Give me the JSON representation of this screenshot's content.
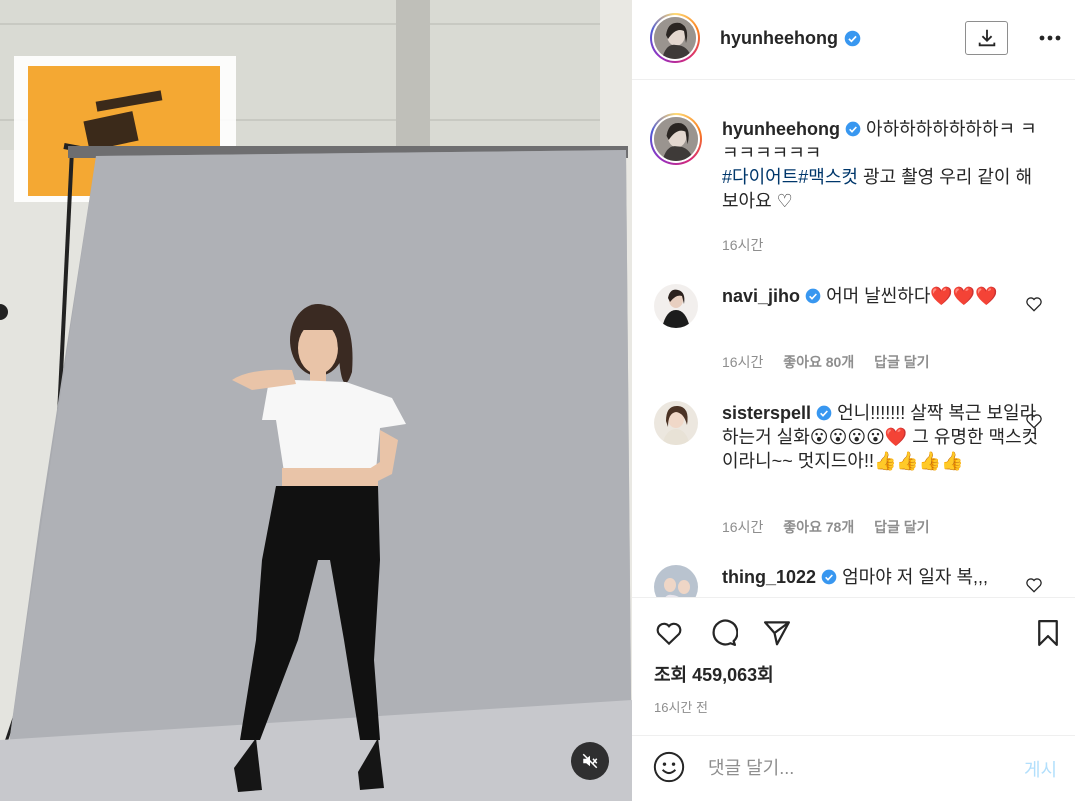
{
  "post": {
    "username": "hyunheehong",
    "verified": true,
    "caption": {
      "text_1": "아하하하하하하하ㅋ ㅋㅋㅋㅋㅋㅋㅋ",
      "hashtag_1": "#다이어트",
      "hashtag_2": "#맥스컷",
      "text_2": " 광고 촬영 우리 같이 해보아요 ♡",
      "time": "16시간"
    },
    "comments": [
      {
        "username": "navi_jiho",
        "verified": true,
        "text": "어머 날씬하다❤️❤️❤️",
        "time": "16시간",
        "likes": "좋아요 80개",
        "reply": "답글 달기"
      },
      {
        "username": "sisterspell",
        "verified": true,
        "text": "언니!!!!!!! 살짝 복근 보일라하는거 실화😮😮😮😮❤️ 그 유명한 맥스컷이라니~~ 멋지드아!!👍👍👍👍",
        "time": "16시간",
        "likes": "좋아요 78개",
        "reply": "답글 달기"
      },
      {
        "username": "thing_1022",
        "verified": true,
        "text": "엄마야 저 일자 복,,,",
        "time": "",
        "likes": "",
        "reply": ""
      }
    ],
    "views": "조회 459,063회",
    "posted_time": "16시간 전",
    "comment_placeholder": "댓글 달기...",
    "post_button": "게시"
  },
  "icons": {
    "download": "download-icon",
    "more": "more-options-icon",
    "like": "heart-icon",
    "comment": "comment-icon",
    "share": "share-icon",
    "save": "bookmark-icon",
    "emoji": "emoji-icon",
    "mute": "speaker-muted-icon"
  },
  "colors": {
    "verified": "#3897f0",
    "hashtag": "#00376b",
    "post_button_disabled": "#b2dffc",
    "muted_text": "#8e8e8e"
  }
}
